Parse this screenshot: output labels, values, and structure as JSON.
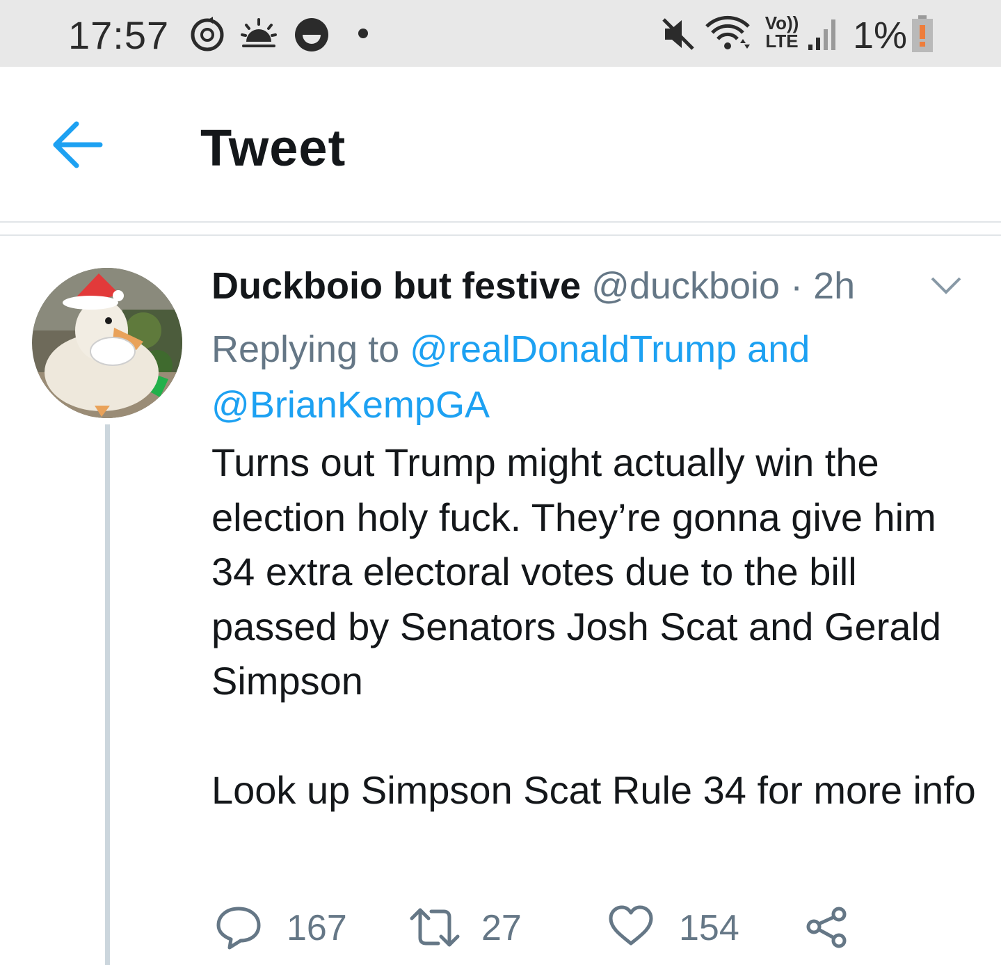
{
  "status_bar": {
    "time": "17:57",
    "battery_percent": "1%",
    "network_label_top": "Vo))",
    "network_label_bottom": "LTE",
    "icons": [
      "sync-icon",
      "weather-icon",
      "app-notification-icon",
      "dot-icon",
      "mute-icon",
      "wifi-icon",
      "signal-icon",
      "battery-low-icon"
    ]
  },
  "header": {
    "title": "Tweet",
    "back_icon": "arrow-left-icon"
  },
  "tweet": {
    "display_name": "Duckboio but festive",
    "handle": "@duckboio",
    "separator": " · ",
    "time": "2h",
    "replying_prefix": "Replying to ",
    "replying_to_1": "@realDonaldTrump",
    "replying_joiner": " and",
    "replying_to_2": "@BrianKempGA",
    "text": "Turns out Trump might actually win the election holy fuck. They’re gonna give him 34 extra electoral votes due to the bill passed by Senators Josh Scat and Gerald Simpson\n\nLook up Simpson Scat Rule 34 for more info"
  },
  "actions": {
    "replies": "167",
    "retweets": "27",
    "likes": "154"
  },
  "colors": {
    "accent": "#1da1f2",
    "secondary_text": "#657786",
    "primary_text": "#14171a",
    "thread_line": "#ccd6dd",
    "status_bar_bg": "#e8e8e8"
  }
}
